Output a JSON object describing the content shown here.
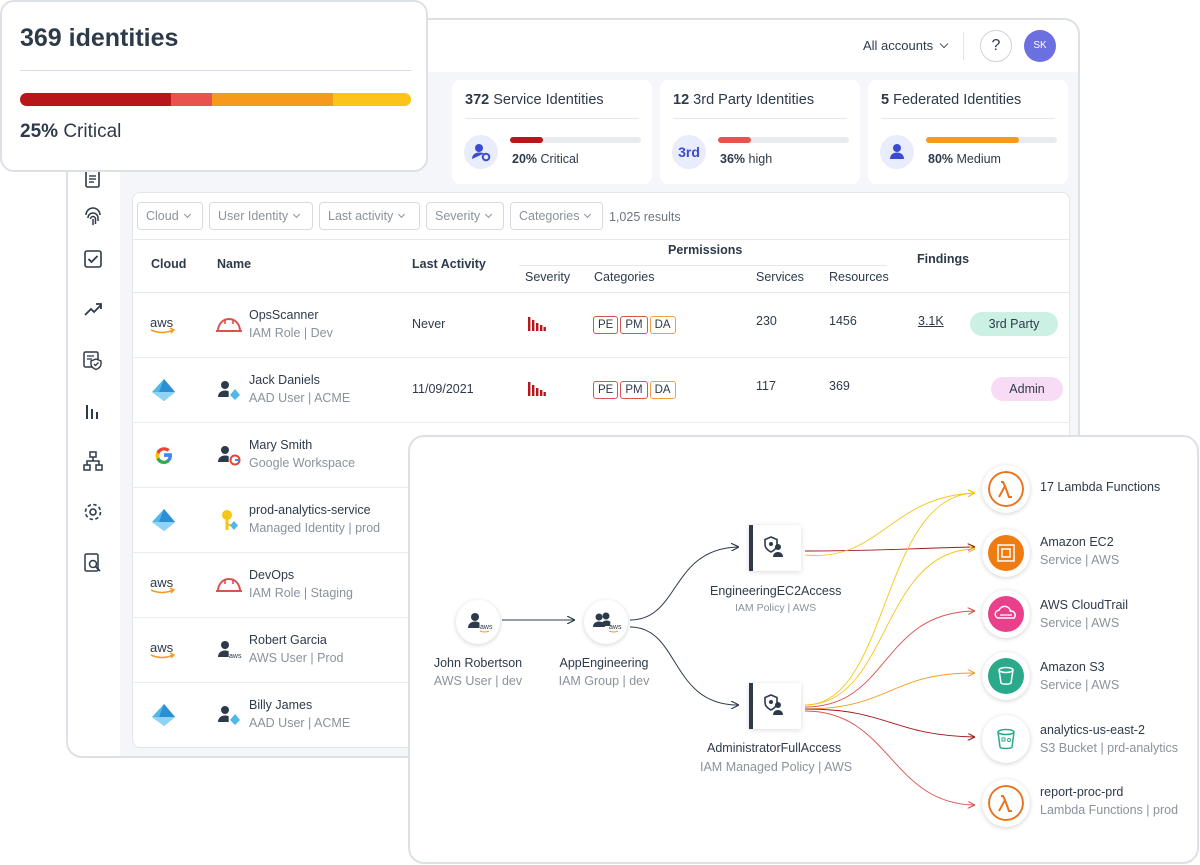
{
  "topbar": {
    "accounts_label": "All accounts",
    "help_label": "?",
    "avatar_initials": "SK"
  },
  "critical_card": {
    "count_label": "369 identities",
    "critical_pct": "25%",
    "critical_label": "Critical",
    "segments": [
      {
        "color": "#b7161b",
        "fraction": 0.385
      },
      {
        "color": "#e8534f",
        "fraction": 0.105
      },
      {
        "color": "#f59a1d",
        "fraction": 0.31
      },
      {
        "color": "#fcc419",
        "fraction": 0.2
      }
    ]
  },
  "cards": [
    {
      "count": "372",
      "label": "Service Identities",
      "pct": "20%",
      "level": "Critical",
      "fill": 0.25,
      "color": "#b7161b",
      "icon": "service-identity-icon"
    },
    {
      "count": "12",
      "label": "3rd Party Identities",
      "pct": "36%",
      "level": "high",
      "fill": 0.25,
      "color": "#e8534f",
      "icon": "third-party-icon",
      "icon_text": "3rd"
    },
    {
      "count": "5",
      "label": "Federated Identities",
      "pct": "80%",
      "level": "Medium",
      "fill": 0.71,
      "color": "#f59a1d",
      "icon": "federated-user-icon"
    }
  ],
  "filters": {
    "items": [
      "Cloud",
      "User Identity",
      "Last activity",
      "Severity",
      "Categories"
    ],
    "results": "1,025 results"
  },
  "table": {
    "headers": {
      "cloud": "Cloud",
      "name": "Name",
      "last_activity": "Last Activity",
      "permissions": "Permissions",
      "severity": "Severity",
      "categories": "Categories",
      "services": "Services",
      "resources": "Resources",
      "findings": "Findings"
    },
    "rows": [
      {
        "cloud": "aws",
        "name": "OpsScanner",
        "sub": "IAM Role | Dev",
        "last": "Never",
        "tags": [
          "PE",
          "PM",
          "DA"
        ],
        "services": "230",
        "resources": "1456",
        "findings": "3.1K",
        "badge": "3rd Party"
      },
      {
        "cloud": "azure",
        "name": "Jack Daniels",
        "sub": "AAD User | ACME",
        "last": "11/09/2021",
        "tags": [
          "PE",
          "PM",
          "DA"
        ],
        "services": "117",
        "resources": "369",
        "findings": "",
        "badge": "Admin"
      },
      {
        "cloud": "google",
        "name": "Mary Smith",
        "sub": "Google Workspace"
      },
      {
        "cloud": "azure",
        "name": "prod-analytics-service",
        "sub": "Managed Identity | prod"
      },
      {
        "cloud": "aws",
        "name": "DevOps",
        "sub": "IAM Role | Staging"
      },
      {
        "cloud": "aws",
        "name": "Robert Garcia",
        "sub": "AWS User | Prod"
      },
      {
        "cloud": "azure",
        "name": "Billy James",
        "sub": "AAD User | ACME"
      }
    ]
  },
  "graph": {
    "user": {
      "label": "John Robertson",
      "sub": "AWS User | dev",
      "badge": "aws"
    },
    "group": {
      "label": "AppEngineering",
      "sub": "IAM Group | dev",
      "badge": "aws"
    },
    "policy1": {
      "label": "EngineeringEC2Access",
      "sub": "IAM Policy | AWS"
    },
    "policy2": {
      "label": "AdministratorFullAccess",
      "sub": "IAM Managed Policy | AWS"
    },
    "resources": [
      {
        "label": "17 Lambda Functions",
        "sub": ""
      },
      {
        "label": "Amazon EC2",
        "sub": "Service | AWS"
      },
      {
        "label": "AWS CloudTrail",
        "sub": "Service | AWS"
      },
      {
        "label": "Amazon S3",
        "sub": "Service | AWS"
      },
      {
        "label": "analytics-us-east-2",
        "sub": "S3 Bucket | prd-analytics"
      },
      {
        "label": "report-proc-prd",
        "sub": "Lambda Functions | prod"
      }
    ]
  }
}
